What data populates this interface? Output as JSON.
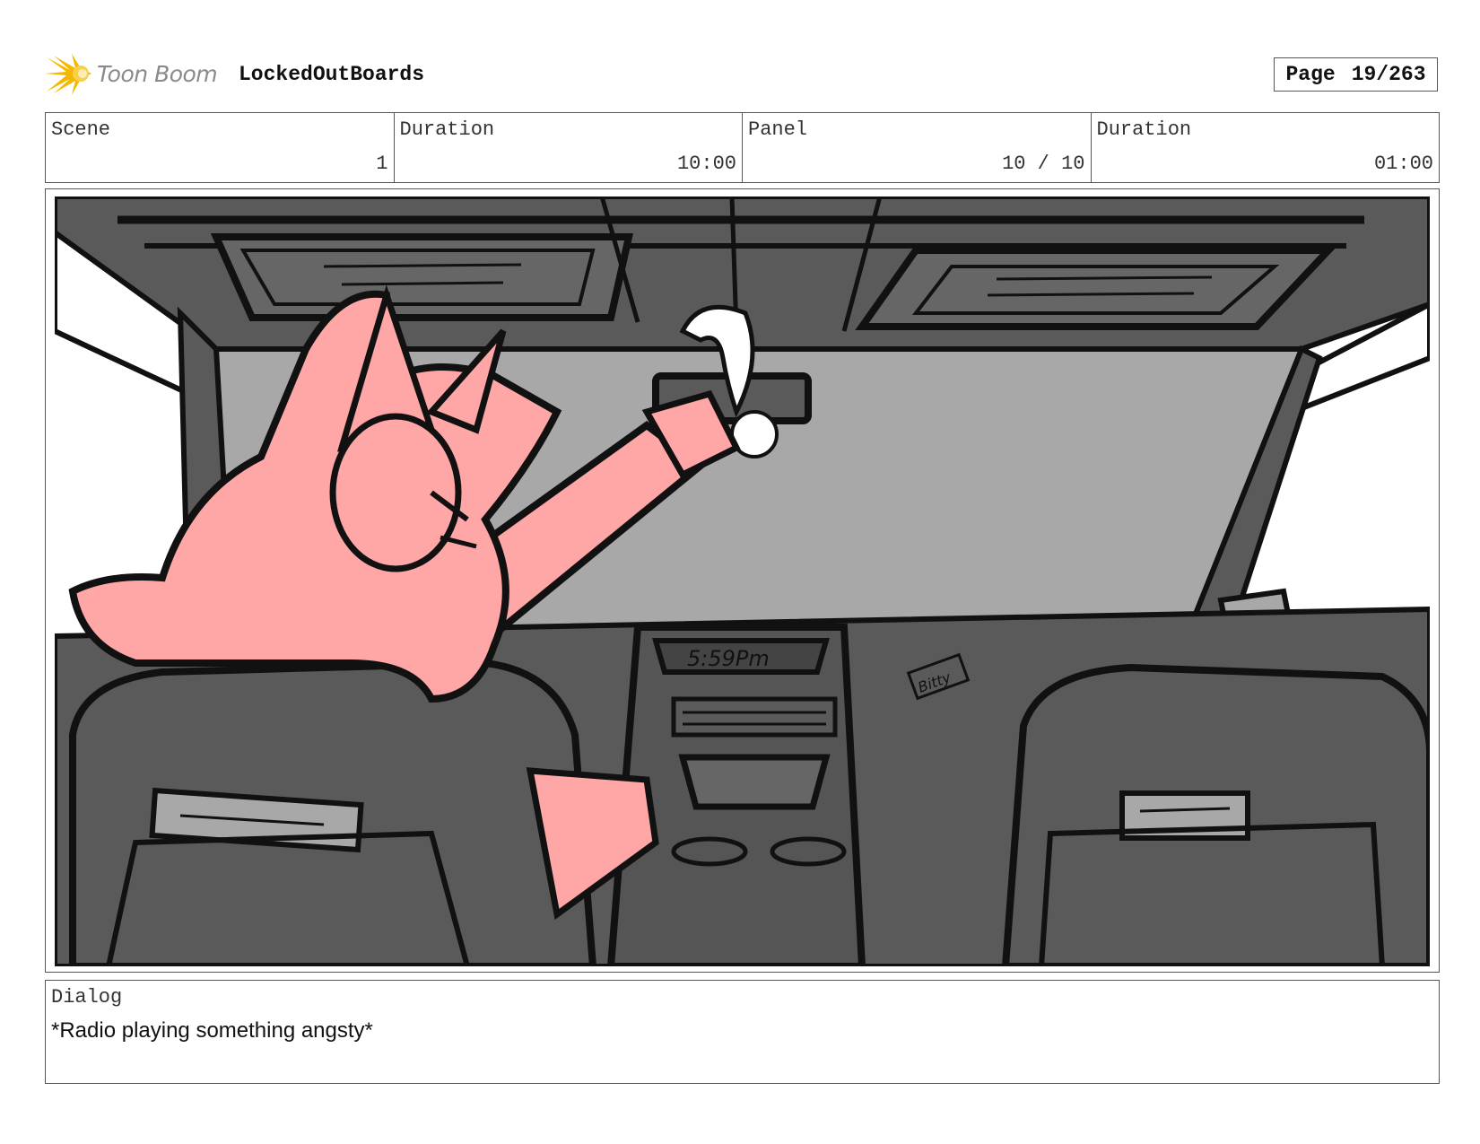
{
  "header": {
    "logo_text": "Toon Boom",
    "project_title": "LockedOutBoards",
    "page_label": "Page",
    "page_value": "19/263"
  },
  "info": {
    "scene_label": "Scene",
    "scene_value": "1",
    "scene_duration_label": "Duration",
    "scene_duration_value": "10:00",
    "panel_label": "Panel",
    "panel_value": "10 / 10",
    "panel_duration_label": "Duration",
    "panel_duration_value": "01:00"
  },
  "panel": {
    "clock_text": "5:59Pm",
    "sign_text": "Bitty"
  },
  "dialog": {
    "label": "Dialog",
    "text": "*Radio playing something angsty*"
  },
  "colors": {
    "pink": "#ffa6a6",
    "dark_gray": "#5a5a5a",
    "mid_gray": "#a8a8a8",
    "logo_yellow": "#f5b800"
  }
}
